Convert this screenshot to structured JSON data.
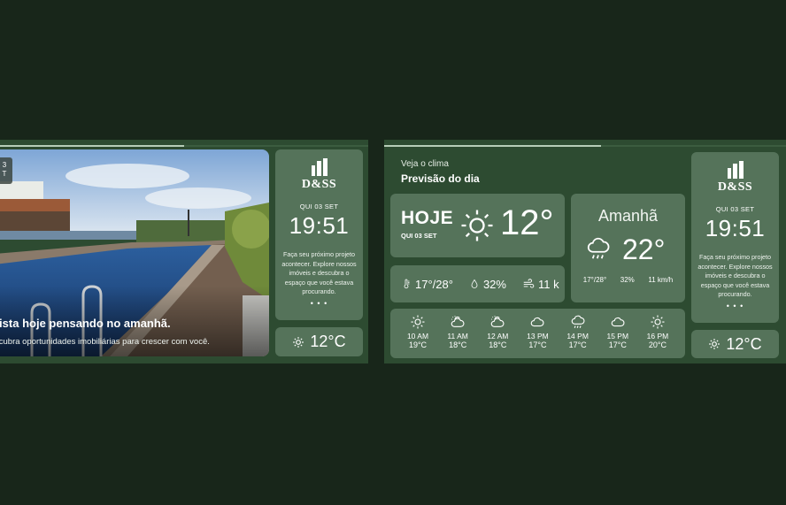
{
  "brand": {
    "logo_text": "D&SS"
  },
  "left_screen": {
    "progress": 0.5,
    "chip_text": "3\nT",
    "headline": "rista hoje pensando no amanhã.",
    "subtext": "scubra oportunidades imobiliárias para crescer com você.",
    "clock_card": {
      "date": "QUI 03 SET",
      "time": "19:51",
      "promo": "Faça seu próximo projeto acontecer. Explore nossos imóveis e descubra o espaço que você estava procurando.",
      "dots": "• • •"
    },
    "temp_card": {
      "icon": "sun-icon",
      "temp": "12°C"
    }
  },
  "right_screen": {
    "progress": 0.54,
    "label": "Veja o clima",
    "title": "Previsão do dia",
    "today": {
      "label": "HOJE",
      "date": "QUI 03 SET",
      "icon": "sun-icon",
      "temp": "12°"
    },
    "tomorrow": {
      "label": "Amanhã",
      "icon": "rain-cloud-icon",
      "temp": "22°",
      "minmax": "17°/28°",
      "humidity": "32%",
      "wind": "11 km/h"
    },
    "stats": {
      "minmax": "17°/28°",
      "humidity": "32%",
      "wind": "11 k"
    },
    "hourly": [
      {
        "time": "10 AM",
        "temp": "19°C",
        "icon": "sun-icon"
      },
      {
        "time": "11 AM",
        "temp": "18°C",
        "icon": "partly-cloudy-icon"
      },
      {
        "time": "12 AM",
        "temp": "18°C",
        "icon": "partly-cloudy-icon"
      },
      {
        "time": "13 PM",
        "temp": "17°C",
        "icon": "cloud-icon"
      },
      {
        "time": "14 PM",
        "temp": "17°C",
        "icon": "rain-cloud-icon"
      },
      {
        "time": "15 PM",
        "temp": "17°C",
        "icon": "cloud-icon"
      },
      {
        "time": "16 PM",
        "temp": "20°C",
        "icon": "sun-icon"
      }
    ],
    "clock_card": {
      "date": "QUI 03 SET",
      "time": "19:51",
      "promo": "Faça seu próximo projeto acontecer. Explore nossos imóveis e descubra o espaço que você estava procurando.",
      "dots": "• • •"
    },
    "temp_card": {
      "icon": "sun-icon",
      "temp": "12°C"
    }
  },
  "colors": {
    "background": "#18261a",
    "screen": "#2d4b31",
    "card": "#55735a",
    "progress": "#b7cdb8"
  }
}
